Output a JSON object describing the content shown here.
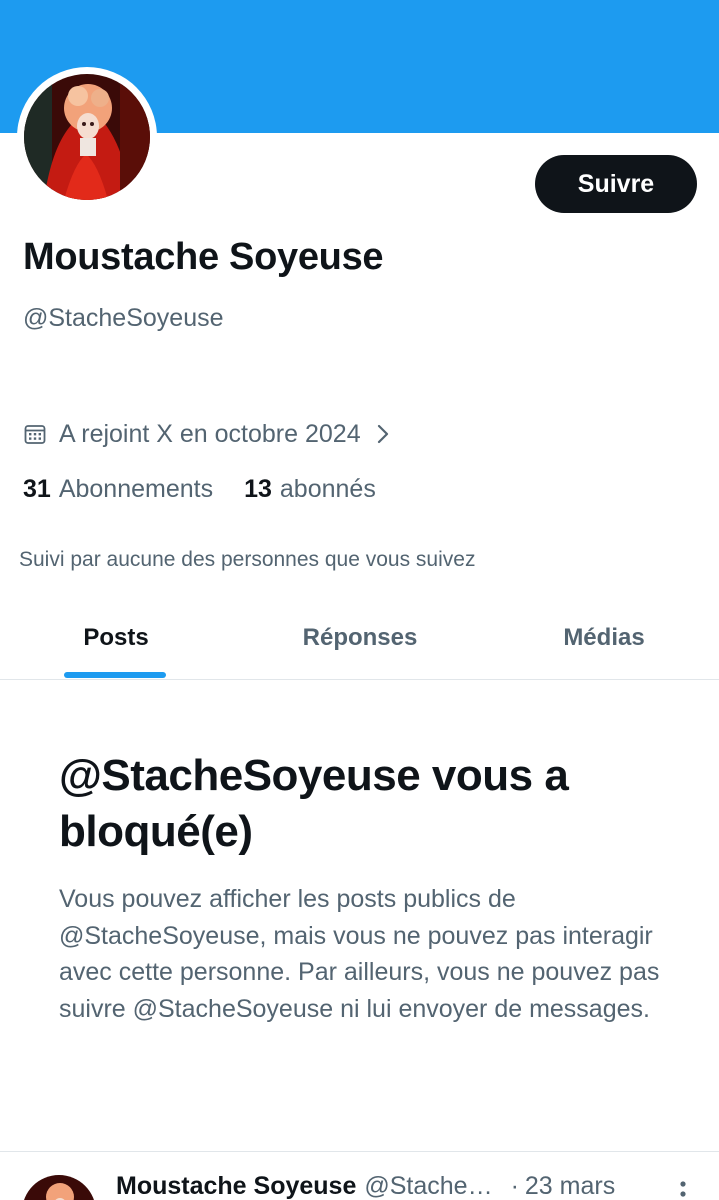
{
  "profile": {
    "display_name": "Moustache Soyeuse",
    "handle": "@StacheSoyeuse",
    "follow_label": "Suivre",
    "joined": "A rejoint X en octobre 2024",
    "following_count": "31",
    "following_label": "Abonnements",
    "followers_count": "13",
    "followers_label": "abonnés",
    "followed_by": "Suivi par aucune des personnes que vous suivez"
  },
  "tabs": [
    {
      "label": "Posts",
      "active": true
    },
    {
      "label": "Réponses",
      "active": false
    },
    {
      "label": "Médias",
      "active": false
    }
  ],
  "blocked": {
    "title": "@StacheSoyeuse vous a bloqué(e)",
    "description": "Vous pouvez afficher les posts publics de @StacheSoyeuse, mais vous ne pouvez pas interagir avec cette personne. Par ailleurs, vous ne pouvez pas suivre @StacheSoyeuse ni lui envoyer de messages."
  },
  "post_preview": {
    "name": "Moustache Soyeuse",
    "handle": "@Stache…",
    "separator": "·",
    "date": "23 mars"
  },
  "colors": {
    "banner": "#1d9bf0",
    "accent": "#1d9bf0",
    "text_primary": "#0f1419",
    "text_secondary": "#536471"
  },
  "icons": {
    "joined": "calendar-icon",
    "joined_more": "chevron-right-icon",
    "post_menu": "more-vertical-icon"
  }
}
